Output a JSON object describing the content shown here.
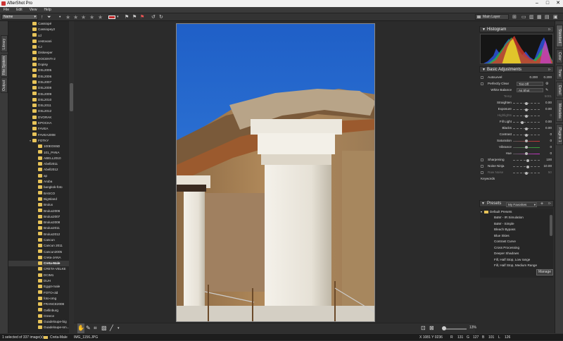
{
  "app": {
    "title": "AfterShot Pro"
  },
  "menu": [
    "File",
    "Edit",
    "View",
    "Help"
  ],
  "toolbar": {
    "sort_label": "Name",
    "layout_select": "Main Layer"
  },
  "left_tabs": [
    "Library",
    "File System",
    "Output"
  ],
  "right_tabs": [
    "Standard",
    "Color",
    "Tone",
    "Detail",
    "Metadata",
    "Plugins 1"
  ],
  "tree": {
    "items": [
      "Cassiopé",
      "Cassiopey2",
      "cd",
      "cestovani",
      "CJ",
      "Diskeeper",
      "DOCENTI-2",
      "Dopisy",
      "DSL2005",
      "DSL2006",
      "DSL2007",
      "DSL2008",
      "DSL2009",
      "DSL2010",
      "DSL2011",
      "DSL2012",
      "DVORAK",
      "EPOCHA",
      "FAVEA",
      "FAVEA2008",
      "FOTKY",
      "100EOS5D",
      "101_PANA",
      "ABELL2010",
      "Abell2011",
      "Abell2012",
      "ap",
      "Aruba",
      "bangkok-foto",
      "BASCO",
      "BigIsland",
      "Brulux",
      "Brulux2006",
      "Brulux2007",
      "Brulux2008",
      "Brulux2011",
      "Brulux2012",
      "Cancun",
      "Cancun 2011",
      "Cancun2005",
      "Creta-JANA",
      "Creta-Male",
      "CRETA-VELKE",
      "DCIM1",
      "DUH",
      "Egypt-male",
      "FOTO-old",
      "foto-omg",
      "FRANCE2008",
      "Gellinburg",
      "Greece",
      "Guadeloupe-big",
      "Guadeloupe-sm..."
    ],
    "selected": "Creta-Male"
  },
  "status": {
    "selection": "1 selected of 337 image(s)",
    "folder": "Creta-Male",
    "file": "IMG_1156.JPG",
    "coords": "X 1081 Y 0236",
    "r_label": "R",
    "r_val": "131",
    "g_label": "G",
    "g_val": "127",
    "b_label": "B",
    "b_val": "101",
    "l_label": "L",
    "l_val": "126"
  },
  "zoom": {
    "percent": "13%",
    "level": 0.13
  },
  "histogram": {
    "title": "Histogram"
  },
  "adjust": {
    "title": "Basic Adjustments",
    "autolevel": {
      "label": "AutoLevel",
      "v1": "0.200",
      "v2": "0.200"
    },
    "perfect_clear": {
      "label": "Perfectly Clear",
      "value": "Tint Off"
    },
    "white_balance": {
      "label": "White Balance",
      "value": "As Shot"
    },
    "temp": {
      "label": "Temp",
      "value": "5001"
    },
    "rows": [
      {
        "label": "Straighten",
        "value": "0.00",
        "level": 0.5
      },
      {
        "label": "Exposure",
        "value": "0.00",
        "level": 0.5
      },
      {
        "label": "Highlights",
        "value": "0",
        "level": 0.5
      },
      {
        "label": "Fill Light",
        "value": "0.00",
        "level": 0.35
      },
      {
        "label": "Blacks",
        "value": "0.00",
        "level": 0.5
      },
      {
        "label": "Contrast",
        "value": "0",
        "level": 0.5
      },
      {
        "label": "Saturation",
        "value": "0",
        "level": 0.5
      },
      {
        "label": "Vibrance",
        "value": "0",
        "level": 0.5
      },
      {
        "label": "Hue",
        "value": "0",
        "level": 0.5
      },
      {
        "label": "Sharpening",
        "value": "100",
        "level": 0.55
      },
      {
        "label": "Noise Ninja",
        "value": "10.00",
        "level": 0.55
      },
      {
        "label": "Raw Noise",
        "value": "50",
        "level": 0.5
      }
    ],
    "keywords_label": "Keywords"
  },
  "presets": {
    "title": "Presets",
    "selected": "My Favorites",
    "root": "Default Presets",
    "items": [
      "B&W - IR Simulation",
      "B&W - Simple",
      "Bleach Bypass",
      "Blue Skies",
      "Contrast Curve",
      "Cross Processing",
      "Deeper Shadows",
      "Fill, Half Stop, Low range",
      "Fill, Half Stop, Medium Range"
    ],
    "manage_label": "Manage"
  }
}
